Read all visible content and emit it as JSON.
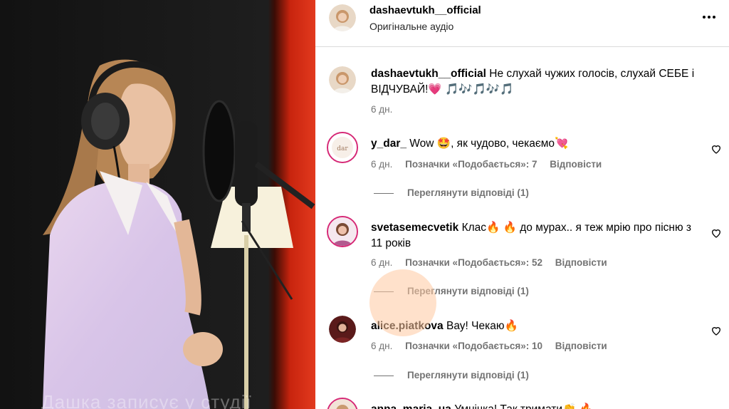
{
  "video": {
    "caption": "Дашка записує у студії"
  },
  "post": {
    "username": "dashaevtukh__official",
    "audio_label": "Оригінальне аудіо"
  },
  "caption_comment": {
    "username": "dashaevtukh__official",
    "text": "Не слухай чужих голосів, слухай СЕБЕ і ВІДЧУВАЙ!💗 🎵🎶🎵🎶🎵",
    "time": "6 дн."
  },
  "comments": [
    {
      "username": "y_dar_",
      "text": "Wow 🤩, як чудово, чекаємо💘",
      "time": "6 дн.",
      "likes": "Позначки «Подобається»: 7",
      "reply_label": "Відповісти",
      "view_replies": "Переглянути відповіді (1)"
    },
    {
      "username": "svetasemecvetik",
      "text": "Клас🔥 🔥 до мурах.. я теж мрію про пісню з 11 років",
      "time": "6 дн.",
      "likes": "Позначки «Подобається»: 52",
      "reply_label": "Відповісти",
      "view_replies": "Переглянути відповіді (1)"
    },
    {
      "username": "alice.piatkova",
      "text": "Вау! Чекаю🔥",
      "time": "6 дн.",
      "likes": "Позначки «Подобається»: 10",
      "reply_label": "Відповісти",
      "view_replies": "Переглянути відповіді (1)"
    },
    {
      "username": "anna_maria_ua",
      "text": "Умнічка! Так тримати👏 🔥"
    }
  ],
  "icons": {
    "more": "more-horizontal-icon",
    "heart": "heart-outline-icon"
  },
  "colors": {
    "secondary_text": "#737373",
    "border": "#dbdbdb",
    "story_ring": "#d62976"
  }
}
